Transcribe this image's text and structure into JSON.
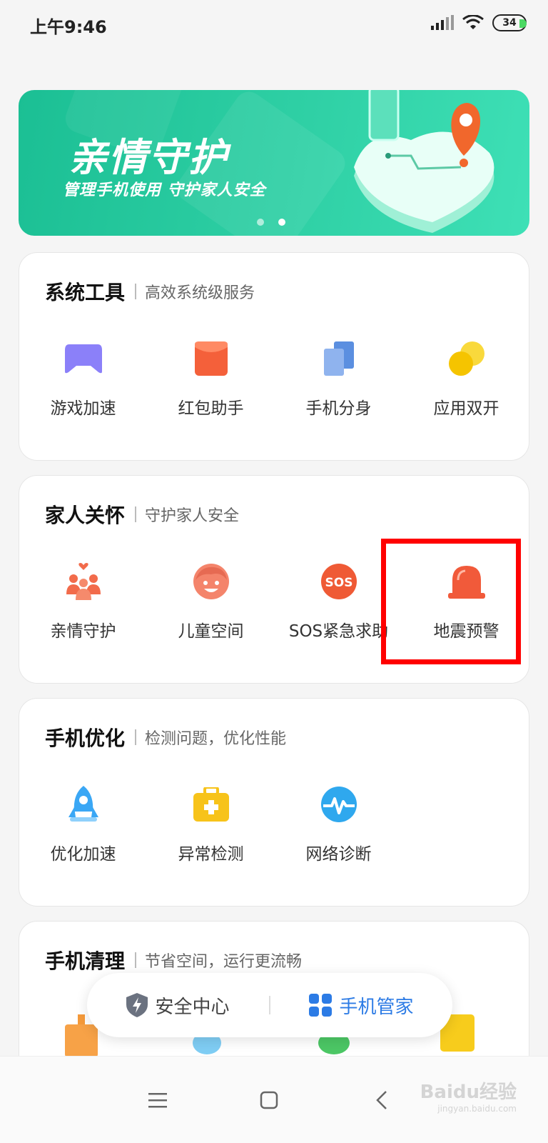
{
  "status": {
    "time": "上午9:46",
    "battery": "34"
  },
  "banner": {
    "title": "亲情守护",
    "subtitle": "管理手机使用 守护家人安全"
  },
  "sections": [
    {
      "title": "系统工具",
      "desc": "高效系统级服务",
      "items": [
        {
          "label": "游戏加速",
          "icon": "gamepad-icon",
          "color": "#8b80f9"
        },
        {
          "label": "红包助手",
          "icon": "red-envelope-icon",
          "color": "#f4603a"
        },
        {
          "label": "手机分身",
          "icon": "dual-phone-icon",
          "color": "#5b8fe0"
        },
        {
          "label": "应用双开",
          "icon": "dual-app-icon",
          "color": "#f5c400"
        }
      ]
    },
    {
      "title": "家人关怀",
      "desc": "守护家人安全",
      "items": [
        {
          "label": "亲情守护",
          "icon": "family-icon",
          "color": "#f26b4b"
        },
        {
          "label": "儿童空间",
          "icon": "child-face-icon",
          "color": "#f4846b"
        },
        {
          "label": "SOS紧急求助",
          "icon": "sos-icon",
          "color": "#ef5a35"
        },
        {
          "label": "地震预警",
          "icon": "alarm-light-icon",
          "color": "#f15a3a"
        }
      ]
    },
    {
      "title": "手机优化",
      "desc": "检测问题，优化性能",
      "items": [
        {
          "label": "优化加速",
          "icon": "rocket-icon",
          "color": "#3aa7f5"
        },
        {
          "label": "异常检测",
          "icon": "medical-kit-icon",
          "color": "#f7c31a"
        },
        {
          "label": "网络诊断",
          "icon": "network-pulse-icon",
          "color": "#2fa8ee"
        }
      ]
    },
    {
      "title": "手机清理",
      "desc": "节省空间，运行更流畅"
    }
  ],
  "tabs": {
    "security": "安全中心",
    "manager": "手机管家"
  },
  "watermark": {
    "brand": "Baidu经验",
    "url": "jingyan.baidu.com"
  }
}
